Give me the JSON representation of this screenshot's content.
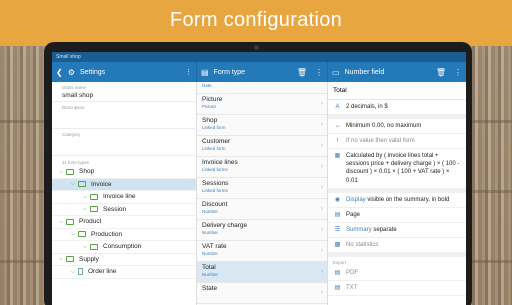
{
  "headline": "Form configuration",
  "statusbar": "Small shop",
  "toolbar": {
    "pane1_title": "Settings",
    "pane2_title": "Form type",
    "pane3_title": "Number field"
  },
  "settings": {
    "order_name_label": "Order name",
    "order_name_value": "small shop",
    "description_label": "Description",
    "category_label": "Category",
    "form_types_label": "11 form types",
    "tree": [
      {
        "label": "Shop",
        "level": 0,
        "kind": "folder",
        "selected": false
      },
      {
        "label": "Invoice",
        "level": 1,
        "kind": "folder",
        "selected": true
      },
      {
        "label": "Invoice line",
        "level": 2,
        "kind": "folder",
        "selected": false
      },
      {
        "label": "Session",
        "level": 2,
        "kind": "folder",
        "selected": false
      },
      {
        "label": "Product",
        "level": 0,
        "kind": "folder",
        "selected": false
      },
      {
        "label": "Production",
        "level": 1,
        "kind": "folder",
        "selected": false
      },
      {
        "label": "Consumption",
        "level": 2,
        "kind": "folder",
        "selected": false
      },
      {
        "label": "Supply",
        "level": 0,
        "kind": "folder",
        "selected": false
      },
      {
        "label": "Order line",
        "level": 1,
        "kind": "doc",
        "selected": false
      }
    ]
  },
  "fields": {
    "first_sub": "Date",
    "items": [
      {
        "name": "Picture",
        "sub": "Picture",
        "selected": false
      },
      {
        "name": "Shop",
        "sub": "Linked form",
        "selected": false
      },
      {
        "name": "Customer",
        "sub": "Linked form",
        "selected": false
      },
      {
        "name": "Invoice lines",
        "sub": "Linked forms",
        "selected": false
      },
      {
        "name": "Sessions",
        "sub": "Linked forms",
        "selected": false
      },
      {
        "name": "Discount",
        "sub": "Number",
        "selected": false
      },
      {
        "name": "Delivery charge",
        "sub": "Number",
        "selected": false
      },
      {
        "name": "VAT rate",
        "sub": "Number",
        "selected": false
      },
      {
        "name": "Total",
        "sub": "Number",
        "selected": true
      },
      {
        "name": "State",
        "sub": "",
        "selected": false
      }
    ]
  },
  "number_field": {
    "title": "Total",
    "decimals": "2 decimals, in $",
    "range": "Minimum 0.00, no maximum",
    "invalid": "If no value then valid form",
    "calc": "Calculated by ( invoice lines total + sessions price + delivery charge ) × ( 100 - discount ) × 0.01 × ( 100 + VAT rate ) × 0.01",
    "display_prefix": "Display",
    "display_rest": " visible on the summary, in bold",
    "page": "Page",
    "summary_prefix": "Summary",
    "summary_rest": " separate",
    "statistics": "No statistics",
    "export_label": "Export",
    "export_items": [
      "PDF",
      "TXT"
    ]
  }
}
